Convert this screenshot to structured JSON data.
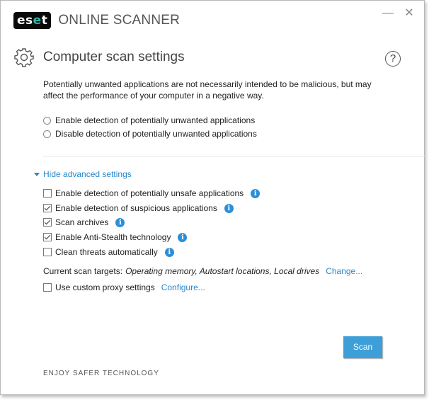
{
  "header": {
    "logo_text": "eset",
    "app_title": "ONLINE SCANNER",
    "minimize_glyph": "—",
    "close_glyph": "✕"
  },
  "section": {
    "title": "Computer scan settings",
    "help_glyph": "?",
    "description": "Potentially unwanted applications are not necessarily intended to be malicious, but may affect the performance of your computer in a negative way."
  },
  "pua_options": [
    {
      "label": "Enable detection of potentially unwanted applications",
      "selected": false
    },
    {
      "label": "Disable detection of potentially unwanted applications",
      "selected": false
    }
  ],
  "advanced": {
    "toggle_label": "Hide advanced settings",
    "options": [
      {
        "label": "Enable detection of potentially unsafe applications",
        "checked": false
      },
      {
        "label": "Enable detection of suspicious applications",
        "checked": true
      },
      {
        "label": "Scan archives",
        "checked": true
      },
      {
        "label": "Enable Anti-Stealth technology",
        "checked": true
      },
      {
        "label": "Clean threats automatically",
        "checked": false
      }
    ],
    "info_glyph": "i",
    "scan_targets_label": "Current scan targets:",
    "scan_targets_value": "Operating memory, Autostart locations, Local drives",
    "change_link": "Change...",
    "proxy_label": "Use custom proxy settings",
    "proxy_checked": false,
    "configure_link": "Configure..."
  },
  "scan_button": "Scan",
  "footer": "ENJOY SAFER TECHNOLOGY",
  "colors": {
    "accent": "#2787c9",
    "button": "#3d9fd8",
    "logo_green": "#2eb8a8"
  },
  "icons": {
    "section": "gear-icon",
    "help": "help-circle-icon",
    "info": "info-icon"
  }
}
